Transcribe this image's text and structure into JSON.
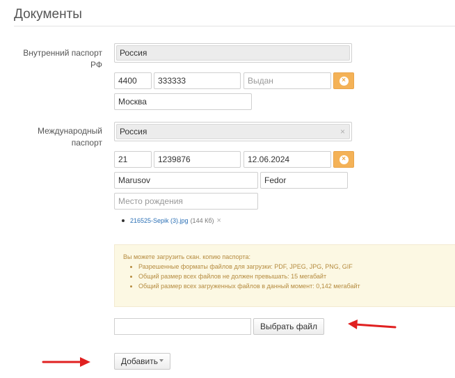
{
  "section": {
    "title": "Документы"
  },
  "internal_passport": {
    "label_line1": "Внутренний паспорт",
    "label_line2": "РФ",
    "country": "Россия",
    "series": "4400",
    "number": "333333",
    "issued_placeholder": "Выдан",
    "clear_icon": "×",
    "city": "Москва"
  },
  "international_passport": {
    "label_line1": "Международный",
    "label_line2": "паспорт",
    "country": "Россия",
    "country_clear": "×",
    "series": "21",
    "number": "1239876",
    "date": "12.06.2024",
    "clear_icon": "×",
    "last_name": "Marusov",
    "first_name": "Fedor",
    "birthplace_placeholder": "Место рождения"
  },
  "attachments": [
    {
      "name": "216525-Sepik (3).jpg",
      "size": "(144 Кб)",
      "remove": "×"
    }
  ],
  "upload_info": {
    "intro": "Вы можете загрузить скан. копию паспорта:",
    "items": [
      "Разрешенные форматы файлов для загрузки: PDF, JPEG, JPG, PNG, GIF",
      "Общий размер всех файлов не должен превышать: 15 мегабайт",
      "Общий размер всех загруженных файлов в данный момент: 0,142 мегабайт"
    ]
  },
  "buttons": {
    "choose_file": "Выбрать файл",
    "add": "Добавить"
  },
  "colors": {
    "accent_orange": "#f4b257",
    "arrow_red": "#e02020",
    "link_blue": "#2a6fb5",
    "info_bg": "#fcf8e3"
  }
}
